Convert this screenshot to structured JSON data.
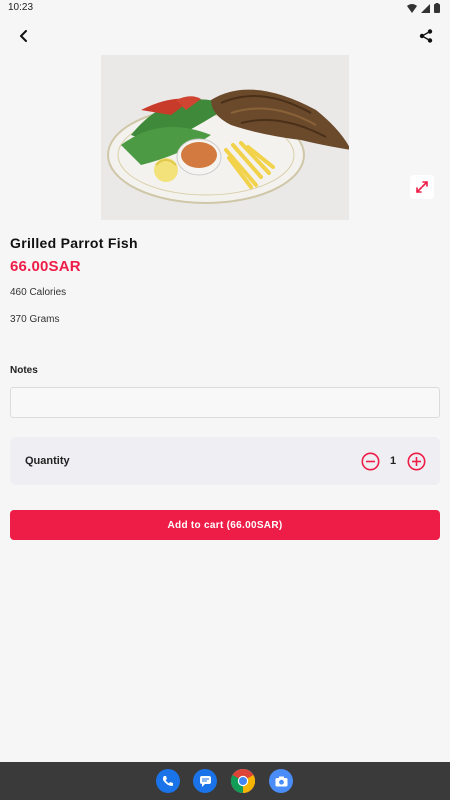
{
  "status_bar": {
    "time": "10:23"
  },
  "product": {
    "name": "Grilled Parrot Fish",
    "price": "66.00SAR",
    "calories": "460 Calories",
    "weight": "370 Grams"
  },
  "notes": {
    "label": "Notes",
    "value": "",
    "placeholder": ""
  },
  "quantity": {
    "label": "Quantity",
    "value": "1"
  },
  "add_to_cart": {
    "label": "Add to cart (66.00SAR)"
  },
  "colors": {
    "accent": "#ee1d48",
    "card": "#efeef2",
    "background": "#f6f6f6"
  },
  "icons": {
    "back": "back-arrow-icon",
    "share": "share-icon",
    "expand": "expand-icon",
    "minus": "minus-circle-icon",
    "plus": "plus-circle-icon"
  },
  "dock": [
    "phone-icon",
    "messages-icon",
    "chrome-icon",
    "camera-icon"
  ]
}
